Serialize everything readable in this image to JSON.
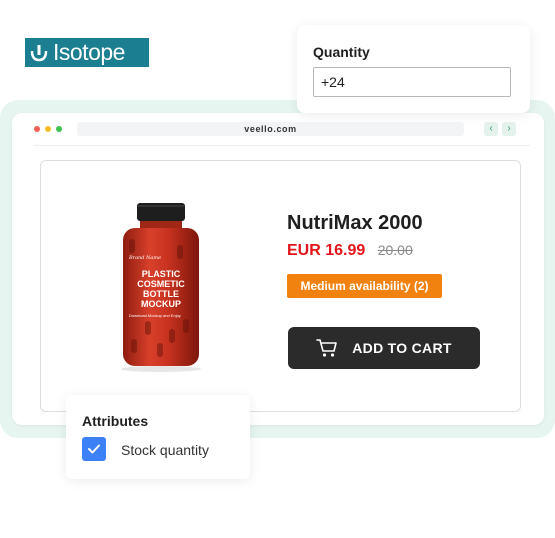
{
  "brand": {
    "name": "Isotope",
    "color": "#1b7f91"
  },
  "browser": {
    "url": "veello.com",
    "back_icon": "chevron-left-icon",
    "forward_icon": "chevron-right-icon"
  },
  "product": {
    "name": "NutriMax 2000",
    "price": "EUR 16.99",
    "old_price": "20.00",
    "availability": "Medium availability (2)",
    "add_to_cart": "ADD TO CART",
    "image_label": {
      "line1": "PLASTIC",
      "line2": "COSMETIC",
      "line3": "BOTTLE",
      "line4": "MOCKUP",
      "script": "Brand Name",
      "small": "Download Mockup and Enjoy"
    }
  },
  "quantity_panel": {
    "title": "Quantity",
    "value": "+24"
  },
  "attributes_panel": {
    "title": "Attributes",
    "checkbox_label": "Stock quantity",
    "checked": true
  },
  "colors": {
    "accent_orange": "#f2820f",
    "price_red": "#e1151b",
    "checkbox_blue": "#3c82f6",
    "button_dark": "#2b2b2b"
  }
}
